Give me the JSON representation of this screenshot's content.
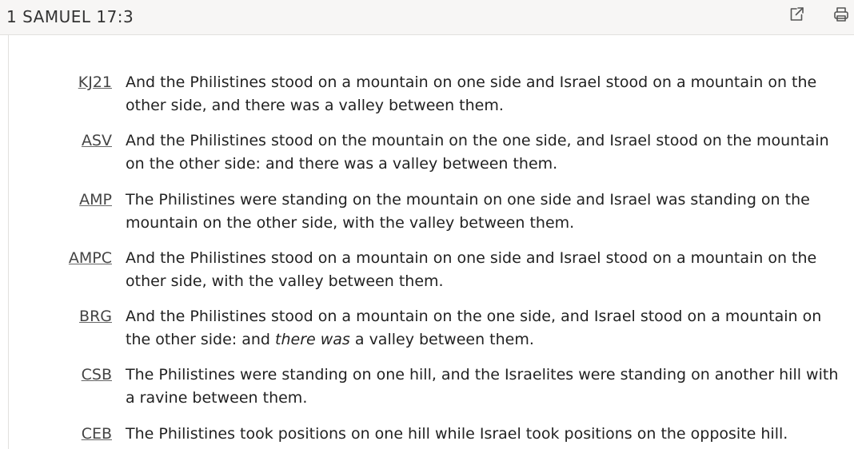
{
  "header": {
    "title": "1 SAMUEL 17:3",
    "icons": [
      "external-link-icon",
      "print-icon"
    ]
  },
  "translations": [
    {
      "abbr": "KJ21",
      "text": "And the Philistines stood on a mountain on one side and Israel stood on a mountain on the other side, and there was a valley between them."
    },
    {
      "abbr": "ASV",
      "text": "And the Philistines stood on the mountain on the one side, and Israel stood on the mountain on the other side: and there was a valley between them."
    },
    {
      "abbr": "AMP",
      "text": "The Philistines were standing on the mountain on one side and Israel was standing on the mountain on the other side, with the valley between them."
    },
    {
      "abbr": "AMPC",
      "text": "And the Philistines stood on a mountain on one side and Israel stood on a mountain on the other side, with the valley between them."
    },
    {
      "abbr": "BRG",
      "text_before": "And the Philistines stood on a mountain on the one side, and Israel stood on a mountain on the other side: and ",
      "text_italic": "there was",
      "text_after": " a valley between them."
    },
    {
      "abbr": "CSB",
      "text": "The Philistines were standing on one hill, and the Israelites were standing on another hill with a ravine between them."
    },
    {
      "abbr": "CEB",
      "text": "The Philistines took positions on one hill while Israel took positions on the opposite hill."
    }
  ]
}
